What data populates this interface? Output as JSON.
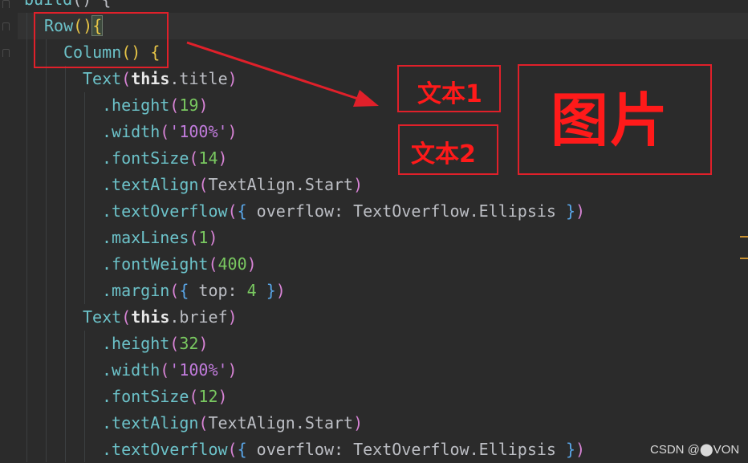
{
  "editor": {
    "code_lines": [
      {
        "tokens": [
          {
            "t": "build",
            "c": "fn"
          },
          {
            "t": "() {",
            "c": "id"
          }
        ]
      },
      {
        "tokens": [
          {
            "t": "Row",
            "c": "fn"
          },
          {
            "t": "()",
            "c": "p1"
          },
          {
            "t": "{",
            "c": "cursor"
          }
        ]
      },
      {
        "tokens": [
          {
            "t": "Column",
            "c": "fn"
          },
          {
            "t": "() {",
            "c": "p1"
          }
        ]
      },
      {
        "tokens": [
          {
            "t": "Text",
            "c": "fn"
          },
          {
            "t": "(",
            "c": "p2"
          },
          {
            "t": "this",
            "c": "kwb"
          },
          {
            "t": ".title",
            "c": "id"
          },
          {
            "t": ")",
            "c": "p2"
          }
        ]
      },
      {
        "tokens": [
          {
            "t": ".height",
            "c": "fn"
          },
          {
            "t": "(",
            "c": "p2"
          },
          {
            "t": "19",
            "c": "num"
          },
          {
            "t": ")",
            "c": "p2"
          }
        ]
      },
      {
        "tokens": [
          {
            "t": ".width",
            "c": "fn"
          },
          {
            "t": "(",
            "c": "p2"
          },
          {
            "t": "'100%'",
            "c": "str"
          },
          {
            "t": ")",
            "c": "p2"
          }
        ]
      },
      {
        "tokens": [
          {
            "t": ".fontSize",
            "c": "fn"
          },
          {
            "t": "(",
            "c": "p2"
          },
          {
            "t": "14",
            "c": "num"
          },
          {
            "t": ")",
            "c": "p2"
          }
        ]
      },
      {
        "tokens": [
          {
            "t": ".textAlign",
            "c": "fn"
          },
          {
            "t": "(",
            "c": "p2"
          },
          {
            "t": "TextAlign.Start",
            "c": "id"
          },
          {
            "t": ")",
            "c": "p2"
          }
        ]
      },
      {
        "tokens": [
          {
            "t": ".textOverflow",
            "c": "fn"
          },
          {
            "t": "(",
            "c": "p2"
          },
          {
            "t": "{",
            "c": "p3"
          },
          {
            "t": " overflow: TextOverflow.Ellipsis ",
            "c": "id"
          },
          {
            "t": "}",
            "c": "p3"
          },
          {
            "t": ")",
            "c": "p2"
          }
        ]
      },
      {
        "tokens": [
          {
            "t": ".maxLines",
            "c": "fn"
          },
          {
            "t": "(",
            "c": "p2"
          },
          {
            "t": "1",
            "c": "num"
          },
          {
            "t": ")",
            "c": "p2"
          }
        ]
      },
      {
        "tokens": [
          {
            "t": ".fontWeight",
            "c": "fn"
          },
          {
            "t": "(",
            "c": "p2"
          },
          {
            "t": "400",
            "c": "num"
          },
          {
            "t": ")",
            "c": "p2"
          }
        ]
      },
      {
        "tokens": [
          {
            "t": ".margin",
            "c": "fn"
          },
          {
            "t": "(",
            "c": "p2"
          },
          {
            "t": "{",
            "c": "p3"
          },
          {
            "t": " top: ",
            "c": "id"
          },
          {
            "t": "4",
            "c": "num"
          },
          {
            "t": " ",
            "c": "id"
          },
          {
            "t": "}",
            "c": "p3"
          },
          {
            "t": ")",
            "c": "p2"
          }
        ]
      },
      {
        "tokens": [
          {
            "t": "Text",
            "c": "fn"
          },
          {
            "t": "(",
            "c": "p2"
          },
          {
            "t": "this",
            "c": "kwb"
          },
          {
            "t": ".brief",
            "c": "id"
          },
          {
            "t": ")",
            "c": "p2"
          }
        ]
      },
      {
        "tokens": [
          {
            "t": ".height",
            "c": "fn"
          },
          {
            "t": "(",
            "c": "p2"
          },
          {
            "t": "32",
            "c": "num"
          },
          {
            "t": ")",
            "c": "p2"
          }
        ]
      },
      {
        "tokens": [
          {
            "t": ".width",
            "c": "fn"
          },
          {
            "t": "(",
            "c": "p2"
          },
          {
            "t": "'100%'",
            "c": "str"
          },
          {
            "t": ")",
            "c": "p2"
          }
        ]
      },
      {
        "tokens": [
          {
            "t": ".fontSize",
            "c": "fn"
          },
          {
            "t": "(",
            "c": "p2"
          },
          {
            "t": "12",
            "c": "num"
          },
          {
            "t": ")",
            "c": "p2"
          }
        ]
      },
      {
        "tokens": [
          {
            "t": ".textAlign",
            "c": "fn"
          },
          {
            "t": "(",
            "c": "p2"
          },
          {
            "t": "TextAlign.Start",
            "c": "id"
          },
          {
            "t": ")",
            "c": "p2"
          }
        ]
      },
      {
        "tokens": [
          {
            "t": ".textOverflow",
            "c": "fn"
          },
          {
            "t": "(",
            "c": "p2"
          },
          {
            "t": "{",
            "c": "p3"
          },
          {
            "t": " overflow: TextOverflow.Ellipsis ",
            "c": "id"
          },
          {
            "t": "}",
            "c": "p3"
          },
          {
            "t": ")",
            "c": "p2"
          }
        ]
      }
    ]
  },
  "annotations": {
    "text1": "文本1",
    "text2": "文本2",
    "image": "图片"
  },
  "colors": {
    "background": "#2b2b2b",
    "annotation_red": "#e0202a",
    "function": "#6cc2c9",
    "number": "#79c860",
    "string": "#c27cdd"
  },
  "watermark": "CSDN @⬤VON"
}
